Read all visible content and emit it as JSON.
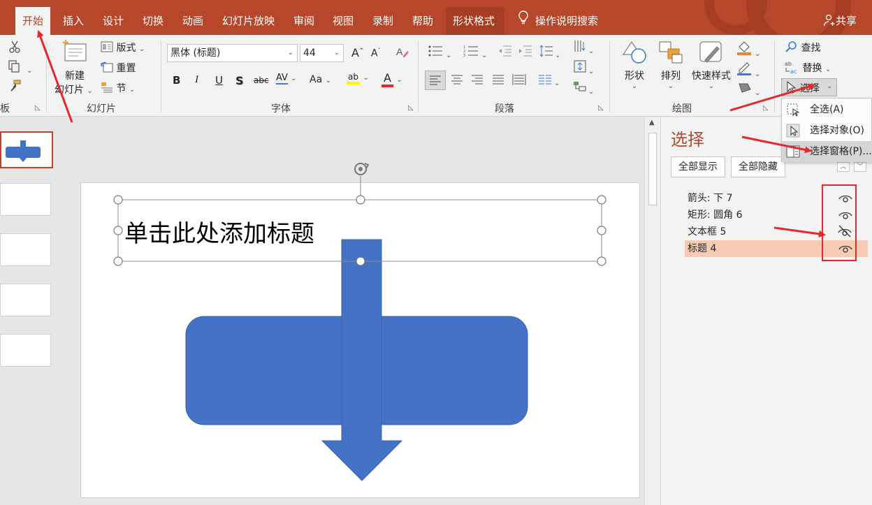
{
  "tabs": [
    {
      "label": "开始",
      "active": true
    },
    {
      "label": "插入"
    },
    {
      "label": "设计"
    },
    {
      "label": "切换"
    },
    {
      "label": "动画"
    },
    {
      "label": "幻灯片放映"
    },
    {
      "label": "审阅"
    },
    {
      "label": "视图"
    },
    {
      "label": "录制"
    },
    {
      "label": "帮助"
    },
    {
      "label": "形状格式",
      "contextual": true
    }
  ],
  "tell_me": "操作说明搜索",
  "share": "共享",
  "ribbon": {
    "clipboard": {
      "label": "板"
    },
    "slides": {
      "label": "幻灯片",
      "new_slide_line1": "新建",
      "new_slide_line2": "幻灯片",
      "layout": "版式",
      "reset": "重置",
      "section": "节"
    },
    "font": {
      "label": "字体",
      "font_name": "黑体 (标题)",
      "font_size": "44",
      "bold": "B",
      "italic": "I",
      "underline": "U",
      "shadow": "S",
      "strike": "abc",
      "spacing": "AV",
      "case": "Aa",
      "grow": "A",
      "shrink": "A",
      "highlight": "ab",
      "color": "A"
    },
    "paragraph": {
      "label": "段落"
    },
    "drawing": {
      "label": "绘图",
      "shapes": "形状",
      "arrange": "排列",
      "quick_styles": "快速样式"
    },
    "editing": {
      "find": "查找",
      "replace": "替换",
      "select": "选择"
    }
  },
  "menu": {
    "items": [
      {
        "label": "全选(A)"
      },
      {
        "label": "选择对象(O)"
      },
      {
        "label": "选择窗格(P)...",
        "highlighted": true
      }
    ]
  },
  "slide": {
    "title_placeholder": "单击此处添加标题"
  },
  "pane": {
    "title": "选择",
    "show_all": "全部显示",
    "hide_all": "全部隐藏",
    "objects": [
      {
        "name": "箭头: 下 7",
        "visible": true
      },
      {
        "name": "矩形: 圆角 6",
        "visible": true
      },
      {
        "name": "文本框 5",
        "visible": false
      },
      {
        "name": "标题 4",
        "visible": true,
        "selected": true
      }
    ]
  },
  "colors": {
    "accent": "#b7472a",
    "shape_fill": "#4472c4",
    "annotation": "#e8262c",
    "selected_row": "#f8cbb5"
  }
}
